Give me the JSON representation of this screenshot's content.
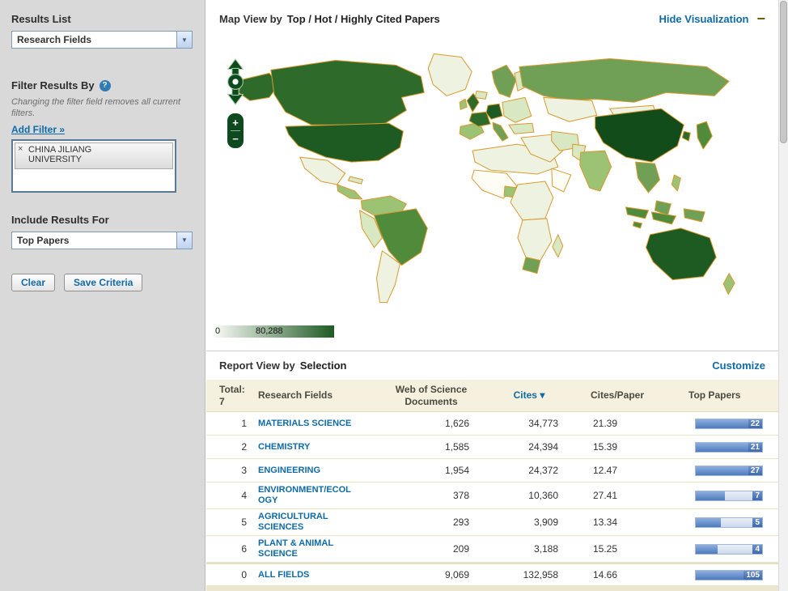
{
  "icons": {
    "chevron_down": "▼",
    "help": "?",
    "remove": "×",
    "sort_down": "▾",
    "collapse": "−",
    "zoom_in": "+",
    "zoom_out": "−"
  },
  "colors": {
    "link": "#0F6BA8",
    "sidebar_bg": "#D9D9D9",
    "header_bg": "#F6F1DE",
    "bar_blue": "#4E7BBE",
    "bar_track": "#CCD9EB",
    "strip": "#EDE6CE"
  },
  "sidebar": {
    "results_list": {
      "label": "Results List",
      "value": "Research Fields"
    },
    "filter": {
      "label": "Filter Results By",
      "note": "Changing the filter field removes all current filters.",
      "add_filter": "Add Filter »",
      "tag_text": "CHINA JILIANG UNIVERSITY"
    },
    "include": {
      "label": "Include Results For",
      "value": "Top Papers"
    },
    "buttons": {
      "clear": "Clear",
      "save": "Save Criteria"
    }
  },
  "map": {
    "title_prefix": "Map View by",
    "title": "Top / Hot / Highly Cited Papers",
    "hide_link": "Hide Visualization",
    "legend": {
      "min": "0",
      "max": "80,288"
    },
    "palette": {
      "stroke": "#D9992E",
      "none": "#FDFDF5",
      "pale": "#EDF3E0",
      "light": "#D8E8C2",
      "medium": "#9CC274",
      "mid": "#6FA055",
      "mdark": "#4F8B3B",
      "dark": "#2E6B2A",
      "darker": "#1E5B22",
      "darkest": "#124C1B",
      "legend_start": "#FCFDFA",
      "legend_end": "#1E5B22",
      "controls": "#0E4A1E"
    }
  },
  "report": {
    "title_prefix": "Report View by",
    "title": "Selection",
    "customize": "Customize"
  },
  "table": {
    "header": {
      "total_label": "Total:",
      "total_value": "7",
      "research_fields": "Research Fields",
      "docs_line1": "Web of Science",
      "docs_line2": "Documents",
      "cites": "Cites",
      "cites_per_paper": "Cites/Paper",
      "top_papers": "Top Papers"
    },
    "rows": [
      {
        "rank": "1",
        "field": "MATERIALS SCIENCE",
        "docs": "1,626",
        "cites": "34,773",
        "cpp": "21.39",
        "top": "22",
        "fill": 100
      },
      {
        "rank": "2",
        "field": "CHEMISTRY",
        "docs": "1,585",
        "cites": "24,394",
        "cpp": "15.39",
        "top": "21",
        "fill": 100
      },
      {
        "rank": "3",
        "field": "ENGINEERING",
        "docs": "1,954",
        "cites": "24,372",
        "cpp": "12.47",
        "top": "27",
        "fill": 100
      },
      {
        "rank": "4",
        "field": "ENVIRONMENT/ECOLOGY",
        "docs": "378",
        "cites": "10,360",
        "cpp": "27.41",
        "top": "7",
        "fill": 44
      },
      {
        "rank": "5",
        "field": "AGRICULTURAL SCIENCES",
        "docs": "293",
        "cites": "3,909",
        "cpp": "13.34",
        "top": "5",
        "fill": 38
      },
      {
        "rank": "6",
        "field": "PLANT & ANIMAL SCIENCE",
        "docs": "209",
        "cites": "3,188",
        "cpp": "15.25",
        "top": "4",
        "fill": 33
      },
      {
        "rank": "0",
        "field": "ALL FIELDS",
        "docs": "9,069",
        "cites": "132,958",
        "cpp": "14.66",
        "top": "105",
        "fill": 100
      }
    ]
  }
}
